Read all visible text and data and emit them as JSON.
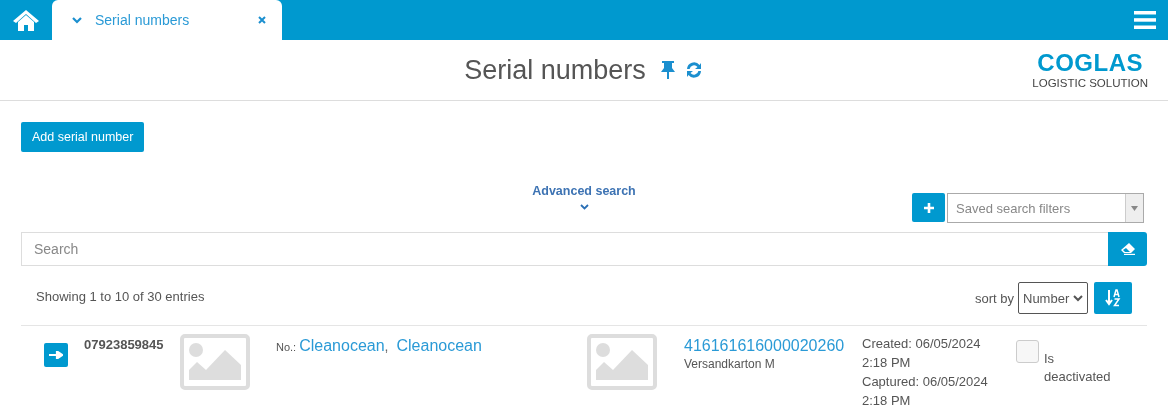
{
  "tabs": [
    {
      "label": "Serial numbers",
      "selected": true
    }
  ],
  "title": "Serial numbers",
  "logo": {
    "name": "COGLAS",
    "tagline": "LOGISTIC SOLUTION"
  },
  "add_button": "Add serial number",
  "advanced_search": {
    "label": "Advanced search",
    "expanded": false
  },
  "saved_filters": {
    "placeholder": "Saved search filters"
  },
  "search": {
    "placeholder": "Search"
  },
  "entries_info": "Showing 1 to 10 of 30 entries",
  "sort": {
    "label": "sort by",
    "value": "Number"
  },
  "rows": [
    {
      "number": "07923859845",
      "no_label": "No.:",
      "names": [
        "Cleanocean",
        "Cleanocean"
      ],
      "name_separator": ",",
      "barcode": "416161616000020260",
      "product": "Versandkarton M",
      "created": "Created: 06/05/2024 2:18 PM",
      "captured": "Captured: 06/05/2024 2:18 PM",
      "deactivated": false,
      "deactivated_label": "Is deactivated"
    }
  ]
}
